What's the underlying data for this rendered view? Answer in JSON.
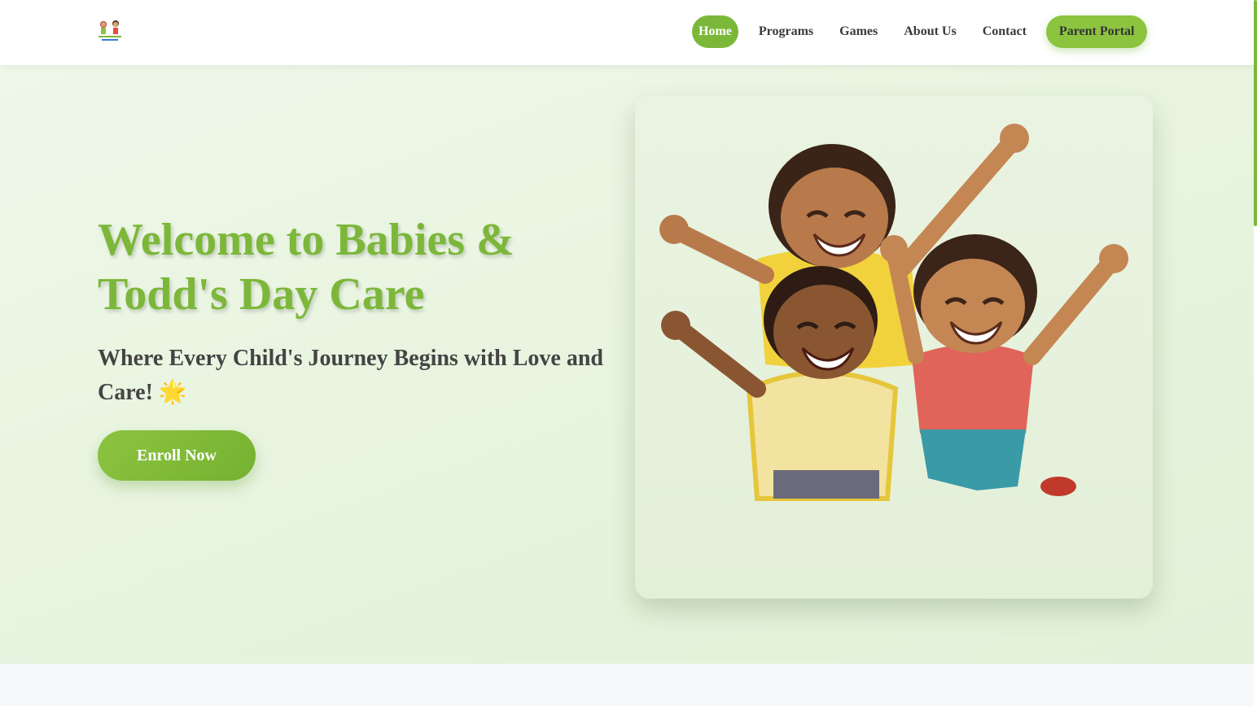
{
  "header": {
    "logo_icon": "daycare-logo-icon",
    "nav": [
      {
        "label": "Home",
        "active": true
      },
      {
        "label": "Programs",
        "active": false
      },
      {
        "label": "Games",
        "active": false
      },
      {
        "label": "About Us",
        "active": false
      },
      {
        "label": "Contact",
        "active": false
      }
    ],
    "cta_label": "Parent Portal"
  },
  "hero": {
    "title": "Welcome to Babies & Todd's Day Care",
    "subtitle": "Where Every Child's Journey Begins with Love and Care! 🌟",
    "button_label": "Enroll Now",
    "image_icon": "happy-children-illustration"
  },
  "colors": {
    "brand_green": "#7cb73a",
    "cta_green": "#8cc43f",
    "hero_background": "#e6f3dd",
    "text_dark": "#444444"
  }
}
